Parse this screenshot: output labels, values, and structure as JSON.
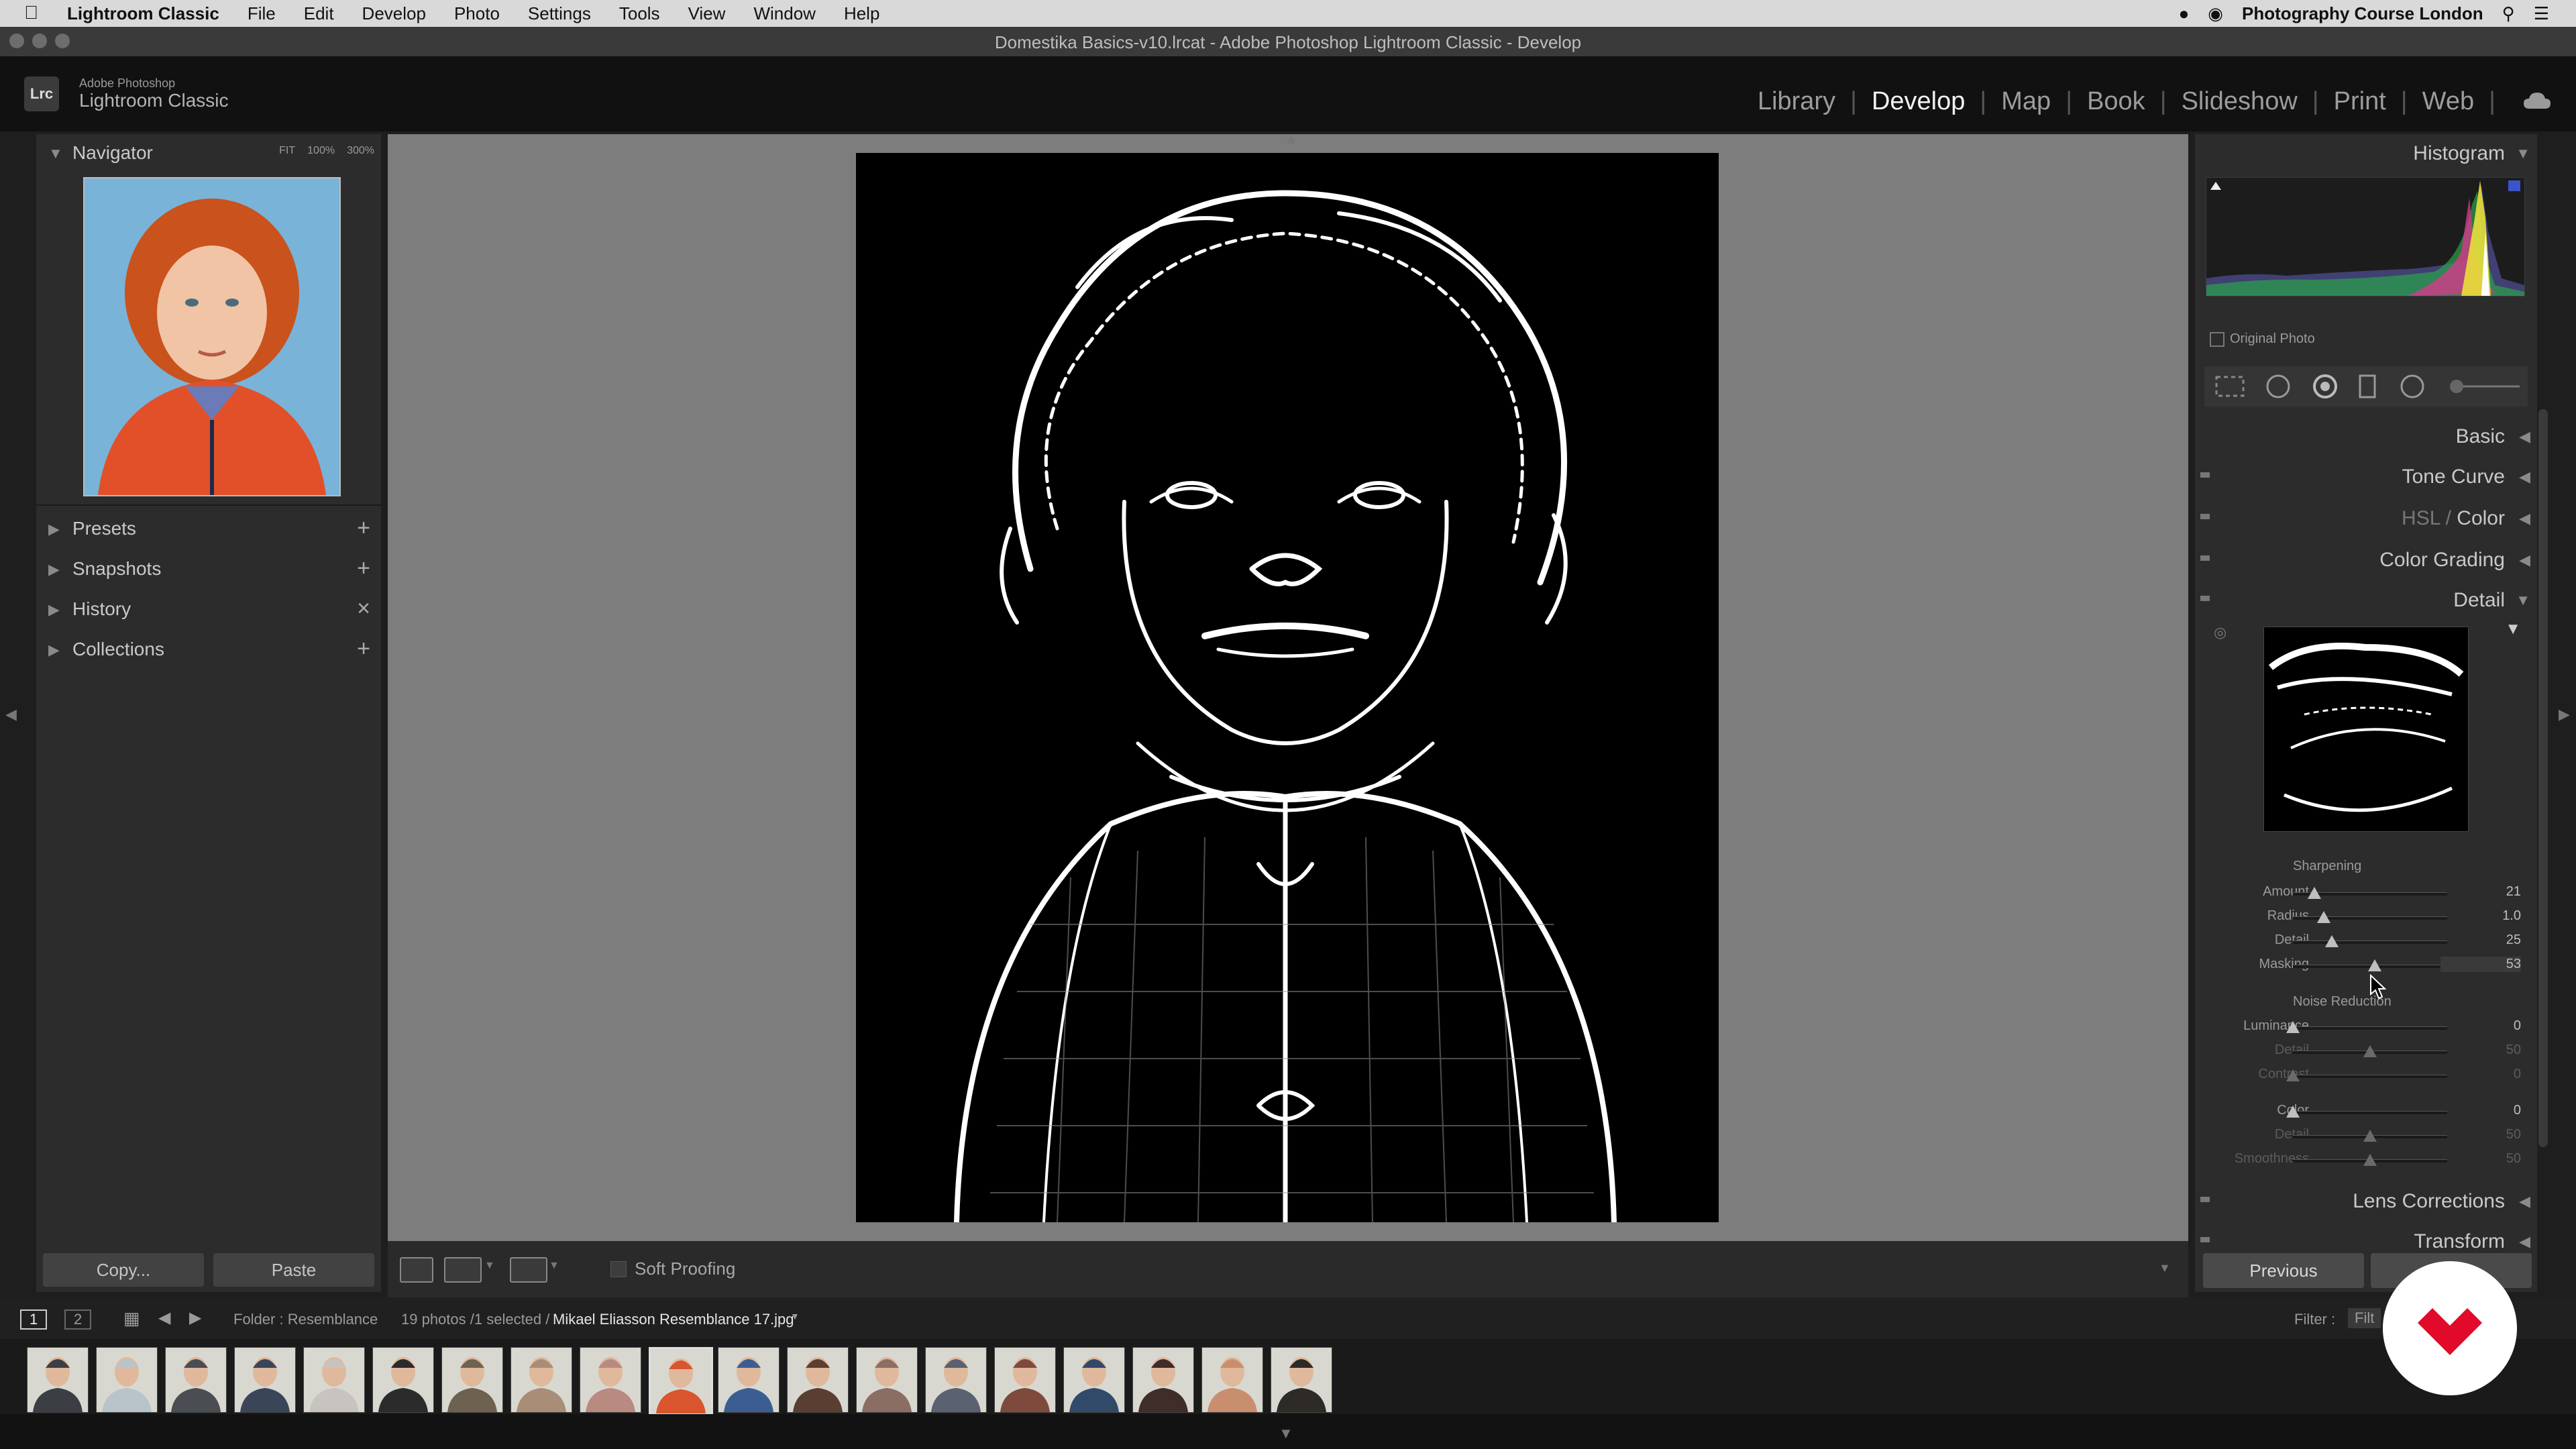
{
  "menubar": {
    "app": "Lightroom Classic",
    "items": [
      "File",
      "Edit",
      "Develop",
      "Photo",
      "Settings",
      "Tools",
      "View",
      "Window",
      "Help"
    ],
    "right_label": "Photography Course London"
  },
  "window": {
    "title": "Domestika Basics-v10.lrcat - Adobe Photoshop Lightroom Classic - Develop"
  },
  "brand": {
    "logo": "Lrc",
    "line1": "Adobe Photoshop",
    "line2": "Lightroom Classic"
  },
  "modules": {
    "items": [
      "Library",
      "Develop",
      "Map",
      "Book",
      "Slideshow",
      "Print",
      "Web"
    ],
    "active": "Develop"
  },
  "left_panel": {
    "navigator": {
      "label": "Navigator",
      "zoom": [
        "FIT",
        "100%",
        "300%"
      ]
    },
    "sections": [
      {
        "label": "Presets",
        "action": "+"
      },
      {
        "label": "Snapshots",
        "action": "+"
      },
      {
        "label": "History",
        "action": "×"
      },
      {
        "label": "Collections",
        "action": "+"
      }
    ],
    "copy_label": "Copy...",
    "paste_label": "Paste"
  },
  "toolbar": {
    "soft_proofing": "Soft Proofing"
  },
  "right_panel": {
    "histogram": "Histogram",
    "original_photo": "Original Photo",
    "sections": [
      "Basic",
      "Tone Curve",
      "HSL / Color",
      "Color Grading",
      "Detail"
    ],
    "hsl_parts": {
      "hsl": "HSL",
      "slash": " / ",
      "color": "Color"
    },
    "sharpening": {
      "title": "Sharpening",
      "sliders": [
        {
          "label": "Amount",
          "value": "21",
          "pos": 0.14
        },
        {
          "label": "Radius",
          "value": "1.0",
          "pos": 0.2
        },
        {
          "label": "Detail",
          "value": "25",
          "pos": 0.25
        },
        {
          "label": "Masking",
          "value": "53",
          "pos": 0.53
        }
      ]
    },
    "noise_reduction": {
      "title": "Noise Reduction",
      "sliders": [
        {
          "label": "Luminance",
          "value": "0",
          "pos": 0.0,
          "dim": false
        },
        {
          "label": "Detail",
          "value": "50",
          "pos": 0.5,
          "dim": true
        },
        {
          "label": "Contrast",
          "value": "0",
          "pos": 0.0,
          "dim": true
        },
        {
          "label": "Color",
          "value": "0",
          "pos": 0.0,
          "dim": false
        },
        {
          "label": "Detail",
          "value": "50",
          "pos": 0.5,
          "dim": true
        },
        {
          "label": "Smoothness",
          "value": "50",
          "pos": 0.5,
          "dim": true
        }
      ]
    },
    "lens_corrections": "Lens Corrections",
    "transform": "Transform",
    "previous_label": "Previous"
  },
  "filmbar": {
    "page1": "1",
    "page2": "2",
    "source": "Folder : Resemblance",
    "count": "19 photos /1 selected /",
    "filename": "Mikael Eliasson Resemblance 17.jpg",
    "filter_label": "Filter :",
    "filter_value": "Filt"
  },
  "filmstrip": {
    "count": 19,
    "selected_index": 9,
    "colors": [
      "#3b3f44",
      "#b9c3ca",
      "#4a4d52",
      "#3a4658",
      "#c9c3c0",
      "#2b2b2b",
      "#6d6250",
      "#a98d77",
      "#b98a7f",
      "#d9552e",
      "#3b5d92",
      "#5b3e32",
      "#8a6d63",
      "#5a6170",
      "#7e4a3c",
      "#324a6a",
      "#3f2d2a",
      "#c98e6e",
      "#2e2a28"
    ]
  },
  "colors": {
    "panel": "#2c2c2c",
    "center_bg": "#7d7d7d",
    "accent": "#ffffff",
    "domestika_red": "#e10a2a"
  }
}
